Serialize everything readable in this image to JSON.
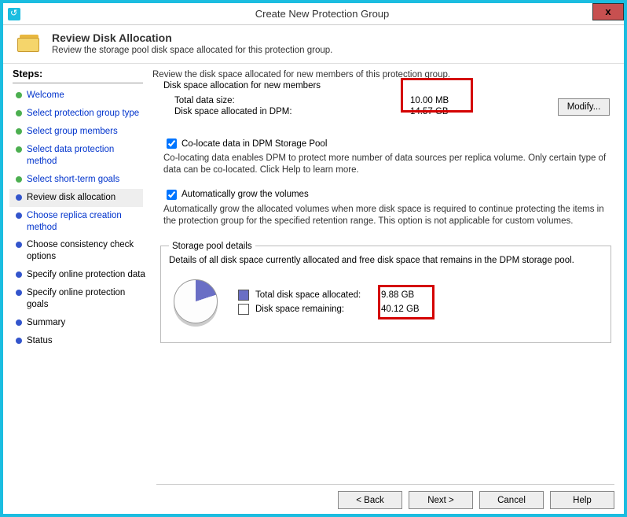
{
  "window": {
    "title": "Create New Protection Group"
  },
  "header": {
    "title": "Review Disk Allocation",
    "subtitle": "Review the storage pool disk space allocated for this protection group."
  },
  "sidebar": {
    "title": "Steps:",
    "items": [
      {
        "label": "Welcome",
        "state": "done"
      },
      {
        "label": "Select protection group type",
        "state": "done"
      },
      {
        "label": "Select group members",
        "state": "done"
      },
      {
        "label": "Select data protection method",
        "state": "done"
      },
      {
        "label": "Select short-term goals",
        "state": "done"
      },
      {
        "label": "Review disk allocation",
        "state": "current"
      },
      {
        "label": "Choose replica creation method",
        "state": "pending-link"
      },
      {
        "label": "Choose consistency check options",
        "state": "pending"
      },
      {
        "label": "Specify online protection data",
        "state": "pending"
      },
      {
        "label": "Specify online protection goals",
        "state": "pending"
      },
      {
        "label": "Summary",
        "state": "pending"
      },
      {
        "label": "Status",
        "state": "pending"
      }
    ]
  },
  "content": {
    "intro": "Review the disk space allocated for new members of this protection group.",
    "group_label": "Disk space allocation for new members",
    "total_data_label": "Total data size:",
    "total_data_value": "10.00 MB",
    "allocated_label": "Disk space allocated in DPM:",
    "allocated_value": "14.57 GB",
    "modify_label": "Modify...",
    "colocate_label": "Co-locate data in DPM Storage Pool",
    "colocate_desc": "Co-locating data enables DPM to protect more number of data sources per replica volume. Only certain type of data can be co-located. Click Help to learn more.",
    "autogrow_label": "Automatically grow the volumes",
    "autogrow_desc": "Automatically grow the allocated volumes when more disk space is required to continue protecting the items in the protection group for the specified retention range. This option is not applicable for custom volumes.",
    "storage_pool": {
      "title": "Storage pool details",
      "desc": "Details of all disk space currently allocated and free disk space that remains in the DPM storage pool.",
      "allocated_label": "Total disk space allocated:",
      "allocated_value": "9.88 GB",
      "remaining_label": "Disk space remaining:",
      "remaining_value": "40.12 GB"
    }
  },
  "buttons": {
    "back": "< Back",
    "next": "Next >",
    "cancel": "Cancel",
    "help": "Help"
  },
  "chart_data": {
    "type": "pie",
    "title": "Storage pool details",
    "series": [
      {
        "name": "Total disk space allocated",
        "value": 9.88,
        "unit": "GB"
      },
      {
        "name": "Disk space remaining",
        "value": 40.12,
        "unit": "GB"
      }
    ]
  }
}
